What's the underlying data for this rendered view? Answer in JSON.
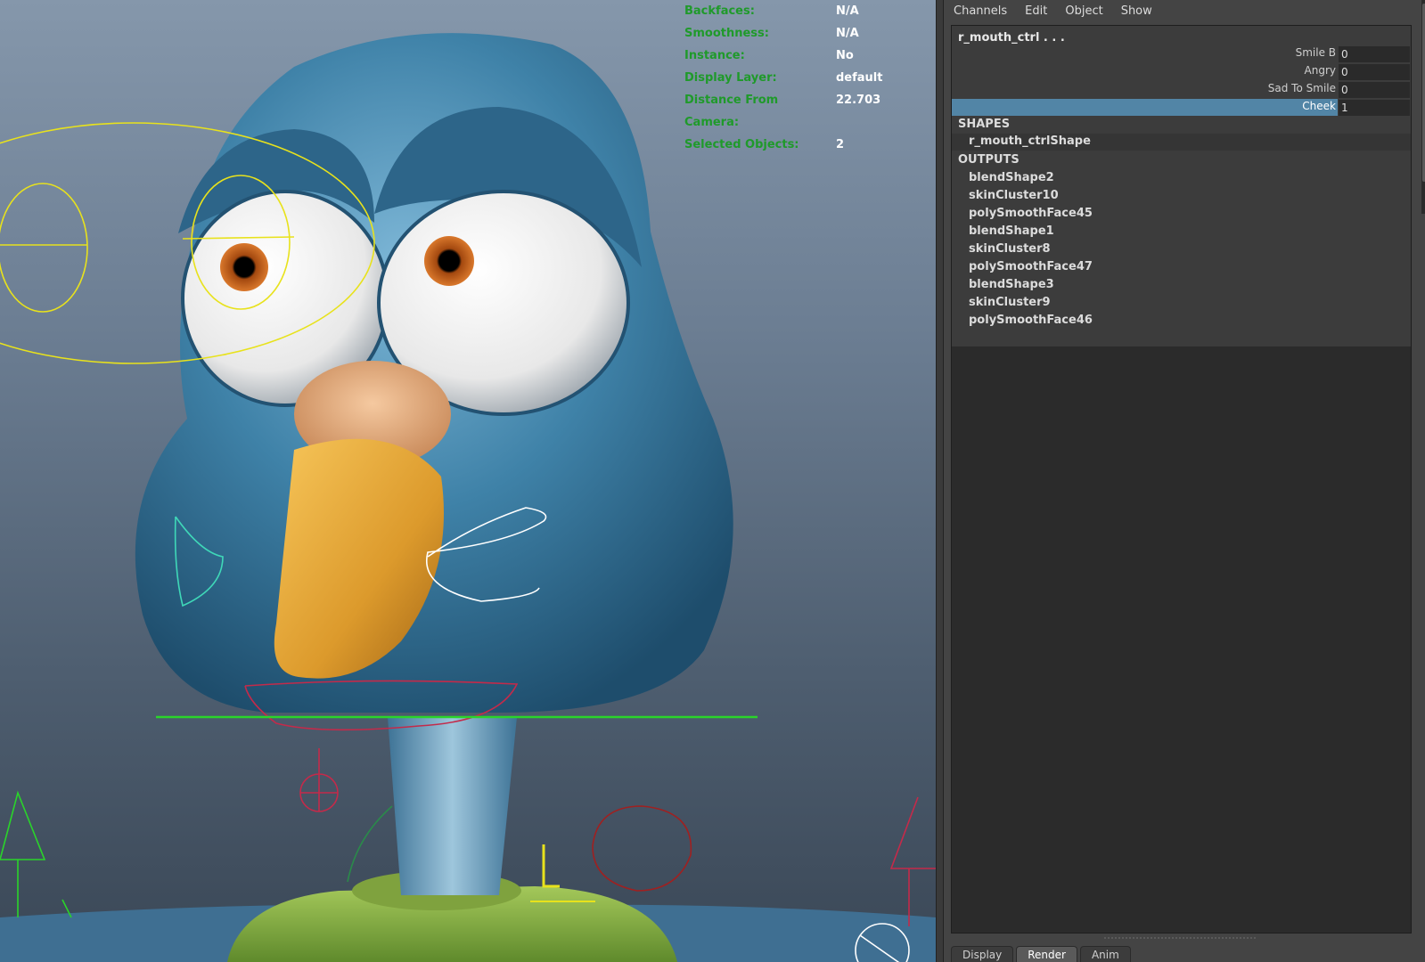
{
  "viewport": {
    "hud": [
      {
        "label": "Backfaces:",
        "value": "N/A"
      },
      {
        "label": "Smoothness:",
        "value": "N/A"
      },
      {
        "label": "Instance:",
        "value": "No"
      },
      {
        "label": "Display Layer:",
        "value": "default"
      },
      {
        "label": "Distance From Camera:",
        "value": "22.703"
      },
      {
        "label": "Selected Objects:",
        "value": "2"
      }
    ],
    "colors": {
      "hud_label": "#1f9a2a",
      "bird_body": "#3d7ea4",
      "beak": "#e2a43a",
      "shirt": "#8fb24a"
    }
  },
  "channel_box": {
    "menu": [
      "Channels",
      "Edit",
      "Object",
      "Show"
    ],
    "node_name": "r_mouth_ctrl . . .",
    "attributes": [
      {
        "label": "Smile B",
        "value": "0",
        "selected": false
      },
      {
        "label": "Angry",
        "value": "0",
        "selected": false
      },
      {
        "label": "Sad To Smile",
        "value": "0",
        "selected": false
      },
      {
        "label": "Cheek",
        "value": "1",
        "selected": true
      }
    ],
    "shapes_header": "SHAPES",
    "shapes": [
      "r_mouth_ctrlShape"
    ],
    "outputs_header": "OUTPUTS",
    "outputs": [
      "blendShape2",
      "skinCluster10",
      "polySmoothFace45",
      "blendShape1",
      "skinCluster8",
      "polySmoothFace47",
      "blendShape3",
      "skinCluster9",
      "polySmoothFace46"
    ],
    "selection_color": "#5285a6"
  },
  "bottom_tabs": [
    {
      "label": "Display",
      "active": false
    },
    {
      "label": "Render",
      "active": true
    },
    {
      "label": "Anim",
      "active": false
    }
  ]
}
